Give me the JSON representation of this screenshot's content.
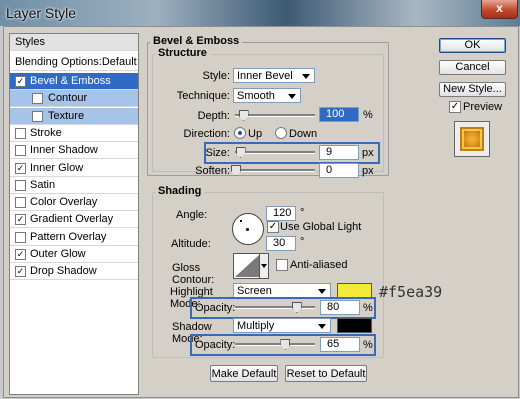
{
  "window": {
    "title": "Layer Style",
    "close_glyph": "x"
  },
  "styles_list": {
    "header": "Styles",
    "blending": "Blending Options:Default",
    "items": [
      {
        "label": "Bevel & Emboss",
        "checked": true,
        "selected": true
      },
      {
        "label": "Contour",
        "checked": false,
        "sub": true
      },
      {
        "label": "Texture",
        "checked": false,
        "sub": true
      },
      {
        "label": "Stroke",
        "checked": false
      },
      {
        "label": "Inner Shadow",
        "checked": false
      },
      {
        "label": "Inner Glow",
        "checked": true
      },
      {
        "label": "Satin",
        "checked": false
      },
      {
        "label": "Color Overlay",
        "checked": false
      },
      {
        "label": "Gradient Overlay",
        "checked": true
      },
      {
        "label": "Pattern Overlay",
        "checked": false
      },
      {
        "label": "Outer Glow",
        "checked": true
      },
      {
        "label": "Drop Shadow",
        "checked": true
      }
    ],
    "check_glyph": "✓"
  },
  "bevel": {
    "title": "Bevel & Emboss",
    "structure_title": "Structure",
    "style_label": "Style:",
    "style_value": "Inner Bevel",
    "technique_label": "Technique:",
    "technique_value": "Smooth",
    "depth_label": "Depth:",
    "depth_value": "100",
    "depth_unit": "%",
    "depth_fraction": 0.1,
    "direction_label": "Direction:",
    "dir_up": "Up",
    "dir_down": "Down",
    "size_label": "Size:",
    "size_value": "9",
    "size_unit": "px",
    "size_fraction": 0.06,
    "soften_label": "Soften:",
    "soften_value": "0",
    "soften_unit": "px",
    "soften_fraction": 0.0
  },
  "shading": {
    "title": "Shading",
    "angle_label": "Angle:",
    "angle_value": "120",
    "angle_unit": "°",
    "global_light": "Use Global Light",
    "altitude_label": "Altitude:",
    "altitude_value": "30",
    "altitude_unit": "°",
    "gloss_label": "Gloss Contour:",
    "anti_aliased": "Anti-aliased",
    "highlight_label": "Highlight Mode:",
    "highlight_value": "Screen",
    "highlight_color": "#f5ea39",
    "hl_opacity_label": "Opacity:",
    "hl_opacity_value": "80",
    "hl_opacity_unit": "%",
    "hl_opacity_fraction": 0.8,
    "shadow_label": "Shadow Mode:",
    "shadow_value": "Multiply",
    "shadow_color": "#000000",
    "sh_opacity_label": "Opacity:",
    "sh_opacity_value": "65",
    "sh_opacity_unit": "%",
    "sh_opacity_fraction": 0.65
  },
  "annotation": "#f5ea39",
  "footer": {
    "make_default": "Make Default",
    "reset_default": "Reset to Default"
  },
  "actions": {
    "ok": "OK",
    "cancel": "Cancel",
    "new_style": "New Style...",
    "preview": "Preview"
  }
}
